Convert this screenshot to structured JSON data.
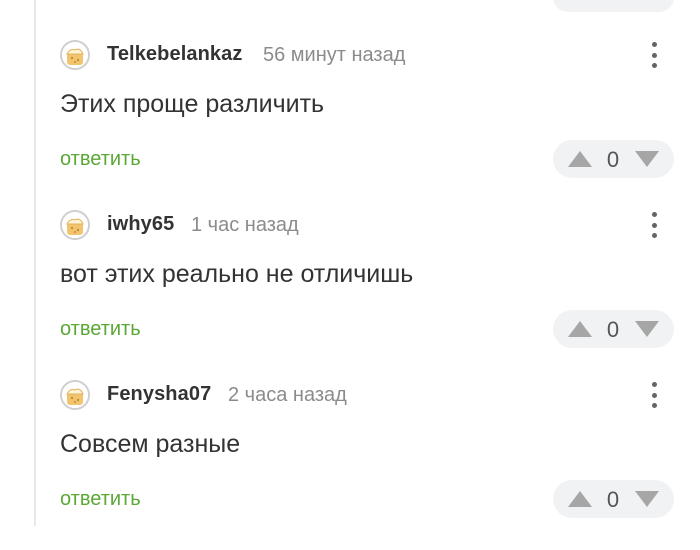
{
  "colors": {
    "reply": "#5aa836",
    "author": "#333333",
    "time": "#8b8b8b",
    "vote_bg": "#f1f2f4",
    "arrows": "#a6a6a6"
  },
  "icons": {
    "avatar": "default-avatar-icon",
    "more": "more-vertical-icon",
    "upvote": "upvote-arrow-icon",
    "downvote": "downvote-arrow-icon"
  },
  "comments": [
    {
      "author": "Telkebelankaz",
      "time": "56 минут назад",
      "text": "Этих проще различить",
      "reply_label": "ответить",
      "votes": "0"
    },
    {
      "author": "iwhy65",
      "time": "1 час назад",
      "text": "вот этих реально не отличишь",
      "reply_label": "ответить",
      "votes": "0"
    },
    {
      "author": "Fenysha07",
      "time": "2 часа назад",
      "text": "Совсем разные",
      "reply_label": "ответить",
      "votes": "0"
    }
  ]
}
